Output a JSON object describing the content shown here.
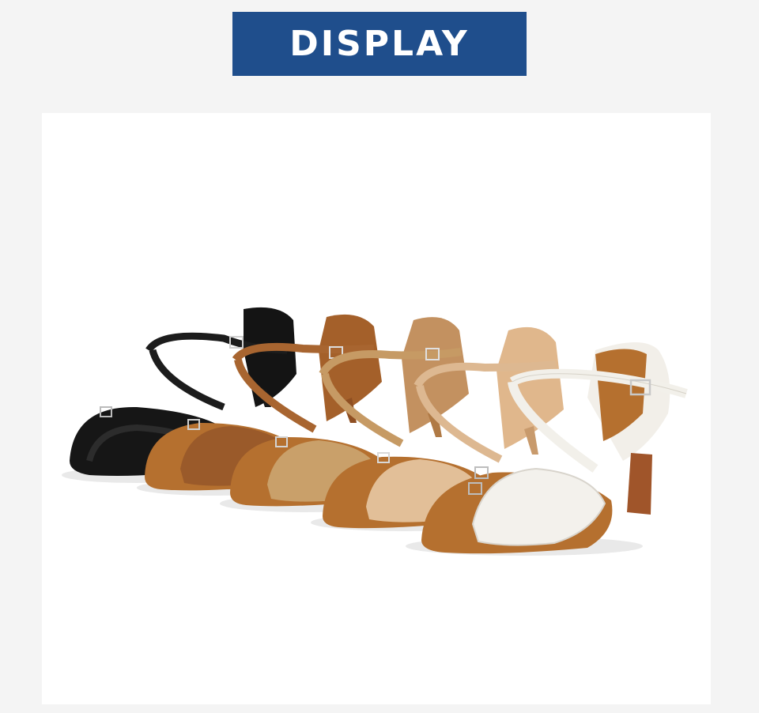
{
  "banner": {
    "title": "DISPLAY",
    "color": "#1f4e8c"
  },
  "photo": {
    "subject": "five-latin-dance-sandals-row",
    "shoe_colors": [
      "#111111",
      "#9a5a2a",
      "#c9a06a",
      "#e2bf98",
      "#f3f1ec"
    ],
    "sole_color": "#b5702f"
  }
}
